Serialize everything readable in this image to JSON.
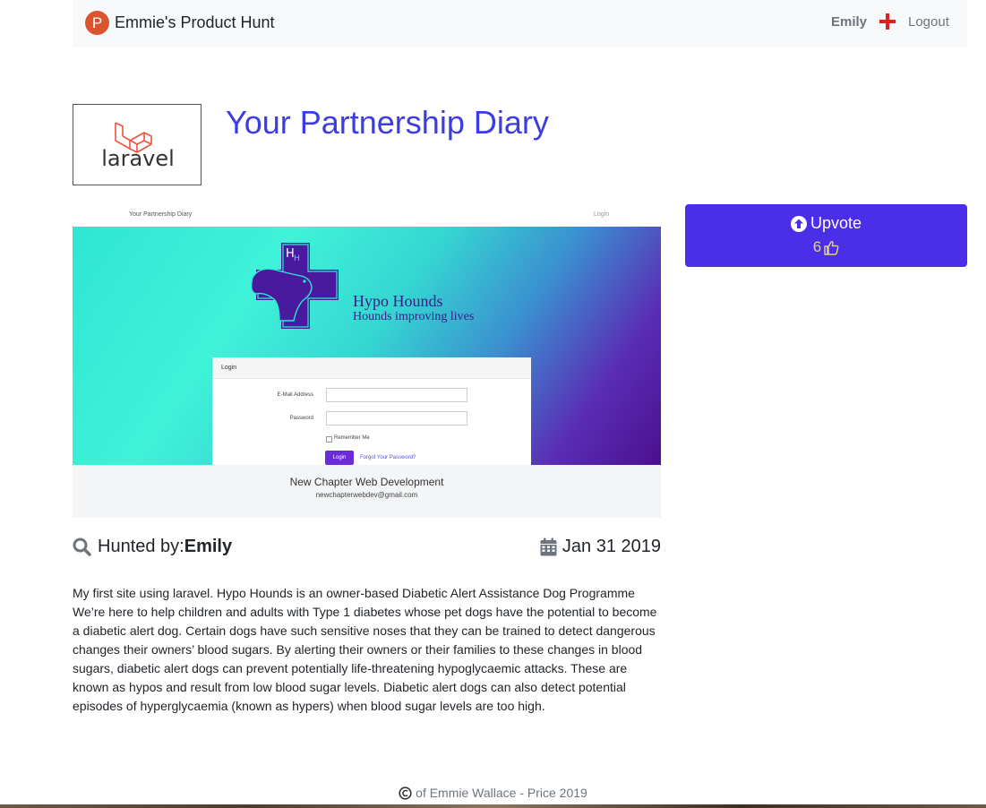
{
  "nav": {
    "brand_letter": "P",
    "brand_name": "Emmie's Product Hunt",
    "user_name": "Emily",
    "plus_icon": "plus-icon",
    "logout_label": "Logout"
  },
  "product": {
    "logo_text": "laravel",
    "title": "Your Partnership Diary",
    "upvote_label": "Upvote",
    "vote_count": "6",
    "hunted_prefix": "Hunted by:",
    "hunter": "Emily",
    "date": "Jan 31 2019",
    "description": "My first site using laravel. Hypo Hounds is an owner-based Diabetic Alert Assistance Dog Programme We’re here to help children and adults with Type 1 diabetes whose pet dogs have the potential to become a diabetic alert dog. Certain dogs have such sensitive noses that they can be trained to detect dangerous changes their owners’ blood sugars. By alerting their owners or their families to these changes in blood sugars, diabetic alert dogs can prevent potentially life-threatening hypoglycaemic attacks. These are known as hypos and result from low blood sugar levels. Diabetic alert dogs can also detect potential episodes of hyperglycaemia (known as hypers) when blood sugar levels are too high."
  },
  "screenshot": {
    "top_title": "Your Partnership Diary",
    "top_login": "Login",
    "brand_name": "Hypo Hounds",
    "brand_tagline": "Hounds improving lives",
    "card_title": "Login",
    "email_label": "E-Mail Address",
    "password_label": "Password",
    "remember_label": "Remember Me",
    "login_button": "Login",
    "forgot_link": "Forgot Your Password?",
    "footer_name": "New Chapter Web Development",
    "footer_email": "newchapterwebdev@gmail.com"
  },
  "footer": {
    "text": "of Emmie Wallace - Price 2019"
  },
  "colors": {
    "brand": "#da552f",
    "title": "#3c3ce6",
    "upvote_bg": "#4b2ee8",
    "vote_count": "#e6d96a",
    "plus": "#e0201b"
  }
}
